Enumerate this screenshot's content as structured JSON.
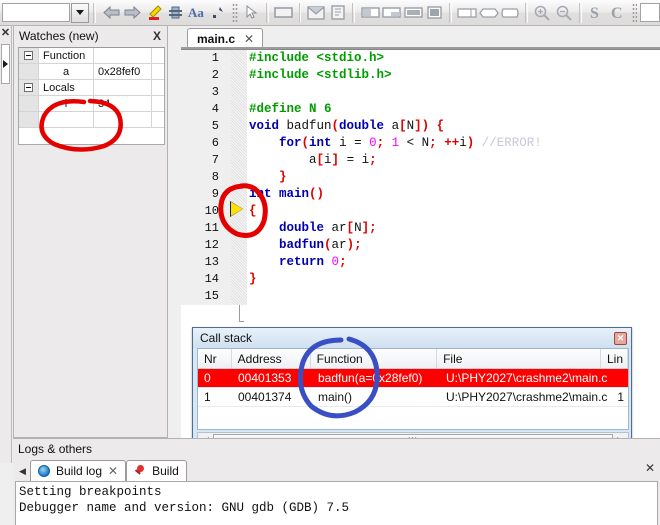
{
  "toolbar": {
    "combo_value": "",
    "icons": [
      {
        "name": "back-arrow-icon"
      },
      {
        "name": "forward-arrow-icon"
      },
      {
        "name": "highlight-pen-icon"
      },
      {
        "name": "bookmark-icon"
      },
      {
        "name": "font-size-icon"
      },
      {
        "name": "select-all-icon"
      },
      {
        "name": "pointer-icon"
      },
      {
        "name": "rectangle-icon"
      },
      {
        "name": "envelope-icon"
      },
      {
        "name": "note-icon"
      },
      {
        "name": "panel-left-icon"
      },
      {
        "name": "panel-right-icon"
      },
      {
        "name": "panel-fill-icon"
      },
      {
        "name": "panel-solid-icon"
      },
      {
        "name": "shape-rect-icon"
      },
      {
        "name": "shape-round-icon"
      },
      {
        "name": "shape-hex-icon"
      },
      {
        "name": "zoom-in-icon"
      },
      {
        "name": "zoom-out-icon"
      },
      {
        "name": "letter-s-icon"
      },
      {
        "name": "letter-c-icon"
      }
    ]
  },
  "leftstrip": {
    "close_label": "✕"
  },
  "watches": {
    "title": "Watches (new)",
    "close_label": "X",
    "rows": [
      {
        "expander": true,
        "name": "Function",
        "value": ""
      },
      {
        "expander": false,
        "name": "a",
        "value": "0x28fef0"
      },
      {
        "expander": true,
        "name": "Locals",
        "value": ""
      },
      {
        "expander": false,
        "name": "i",
        "value": "34"
      },
      {
        "expander": false,
        "name": "",
        "value": ""
      }
    ]
  },
  "editor": {
    "tab_label": "main.c",
    "tab_close": "✕",
    "lines": [
      {
        "n": "1",
        "segments": [
          {
            "t": "#include ",
            "c": "pp"
          },
          {
            "t": "<stdio.h>",
            "c": "pp"
          }
        ]
      },
      {
        "n": "2",
        "segments": [
          {
            "t": "#include ",
            "c": "pp"
          },
          {
            "t": "<stdlib.h>",
            "c": "pp"
          }
        ]
      },
      {
        "n": "3",
        "segments": []
      },
      {
        "n": "4",
        "segments": [
          {
            "t": "#define ",
            "c": "pp"
          },
          {
            "t": "N 6",
            "c": "pp"
          }
        ]
      },
      {
        "n": "5",
        "segments": [
          {
            "t": "void ",
            "c": "kw"
          },
          {
            "t": "badfun",
            "c": "plain"
          },
          {
            "t": "(",
            "c": "pun"
          },
          {
            "t": "double ",
            "c": "kw"
          },
          {
            "t": "a",
            "c": "plain"
          },
          {
            "t": "[",
            "c": "pun"
          },
          {
            "t": "N",
            "c": "plain"
          },
          {
            "t": "]",
            "c": "pun"
          },
          {
            "t": ")",
            "c": "pun"
          },
          {
            "t": " ",
            "c": "plain"
          },
          {
            "t": "{",
            "c": "pun"
          }
        ]
      },
      {
        "n": "6",
        "segments": [
          {
            "t": "    ",
            "c": "plain"
          },
          {
            "t": "for",
            "c": "kw"
          },
          {
            "t": "(",
            "c": "pun"
          },
          {
            "t": "int",
            "c": "kw"
          },
          {
            "t": " i = ",
            "c": "plain"
          },
          {
            "t": "0",
            "c": "num"
          },
          {
            "t": ";",
            "c": "pun"
          },
          {
            "t": " ",
            "c": "plain"
          },
          {
            "t": "1",
            "c": "num"
          },
          {
            "t": " < N",
            "c": "plain"
          },
          {
            "t": ";",
            "c": "pun"
          },
          {
            "t": " ",
            "c": "plain"
          },
          {
            "t": "++",
            "c": "pun"
          },
          {
            "t": "i",
            "c": "plain"
          },
          {
            "t": ")",
            "c": "pun"
          },
          {
            "t": " ",
            "c": "plain"
          },
          {
            "t": "//ERROR!",
            "c": "cmt"
          }
        ]
      },
      {
        "n": "7",
        "segments": [
          {
            "t": "        a",
            "c": "plain"
          },
          {
            "t": "[",
            "c": "pun"
          },
          {
            "t": "i",
            "c": "plain"
          },
          {
            "t": "]",
            "c": "pun"
          },
          {
            "t": " = i",
            "c": "plain"
          },
          {
            "t": ";",
            "c": "pun"
          }
        ]
      },
      {
        "n": "8",
        "segments": [
          {
            "t": "    ",
            "c": "plain"
          },
          {
            "t": "}",
            "c": "pun"
          }
        ]
      },
      {
        "n": "9",
        "segments": [
          {
            "t": "int ",
            "c": "kw"
          },
          {
            "t": "main",
            "c": "kw"
          },
          {
            "t": "(",
            "c": "pun"
          },
          {
            "t": ")",
            "c": "pun"
          }
        ]
      },
      {
        "n": "10",
        "segments": [
          {
            "t": "{",
            "c": "pun"
          }
        ]
      },
      {
        "n": "11",
        "segments": [
          {
            "t": "    ",
            "c": "plain"
          },
          {
            "t": "double",
            "c": "kw"
          },
          {
            "t": " ar",
            "c": "plain"
          },
          {
            "t": "[",
            "c": "pun"
          },
          {
            "t": "N",
            "c": "plain"
          },
          {
            "t": "]",
            "c": "pun"
          },
          {
            "t": ";",
            "c": "pun"
          }
        ]
      },
      {
        "n": "12",
        "segments": [
          {
            "t": "    ",
            "c": "plain"
          },
          {
            "t": "badfun",
            "c": "kw"
          },
          {
            "t": "(",
            "c": "pun"
          },
          {
            "t": "ar",
            "c": "plain"
          },
          {
            "t": ")",
            "c": "pun"
          },
          {
            "t": ";",
            "c": "pun"
          }
        ]
      },
      {
        "n": "13",
        "segments": [
          {
            "t": "    ",
            "c": "plain"
          },
          {
            "t": "return",
            "c": "kw"
          },
          {
            "t": " ",
            "c": "plain"
          },
          {
            "t": "0",
            "c": "num"
          },
          {
            "t": ";",
            "c": "pun"
          }
        ]
      },
      {
        "n": "14",
        "segments": [
          {
            "t": "}",
            "c": "pun"
          }
        ]
      },
      {
        "n": "15",
        "segments": []
      }
    ]
  },
  "callstack": {
    "title": "Call stack",
    "close_label": "✕",
    "columns": [
      "Nr",
      "Address",
      "Function",
      "File",
      "Lin"
    ],
    "rows": [
      {
        "nr": "0",
        "address": "00401353",
        "function": "badfun(a=0x28fef0)",
        "file": "U:\\PHY2027\\crashme2\\main.c",
        "line": "",
        "selected": true
      },
      {
        "nr": "1",
        "address": "00401374",
        "function": "main()",
        "file": "U:\\PHY2027\\crashme2\\main.c",
        "line": "1",
        "selected": false
      }
    ],
    "scroll_left": "◀",
    "scroll_right": "▶",
    "scroll_grip": "III"
  },
  "logs": {
    "title": "Logs & others",
    "nav_arrow": "◀",
    "tabs": [
      {
        "label": "Build log",
        "icon": "gear-icon",
        "close": "✕",
        "active": true
      },
      {
        "label": "Build",
        "icon": "pin-icon",
        "close": "",
        "active": false
      }
    ],
    "close_label": "✕",
    "output": "Setting breakpoints\nDebugger name and version: GNU gdb (GDB) 7.5"
  },
  "annotations": {
    "watch_circle_color": "#e00000",
    "editor_circle_color": "#e00000",
    "callstack_circle_color": "#3b4fc4"
  }
}
